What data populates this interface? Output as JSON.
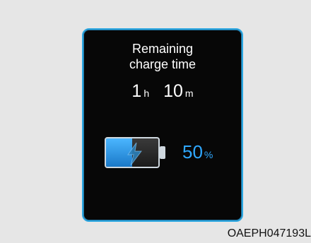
{
  "panel": {
    "title_line1": "Remaining",
    "title_line2": "charge time",
    "hours": "1",
    "hours_unit": "h",
    "minutes": "10",
    "minutes_unit": "m",
    "battery": {
      "percent_value": "50",
      "percent_unit": "%",
      "level": 0.5
    }
  },
  "caption": "OAEPH047193L",
  "colors": {
    "accent": "#2ba6e0",
    "percent_text": "#2fa8ff",
    "background": "#e6e6e6",
    "panel": "#070707"
  },
  "icons": {
    "battery": "battery-icon",
    "bolt": "charging-bolt-icon"
  }
}
